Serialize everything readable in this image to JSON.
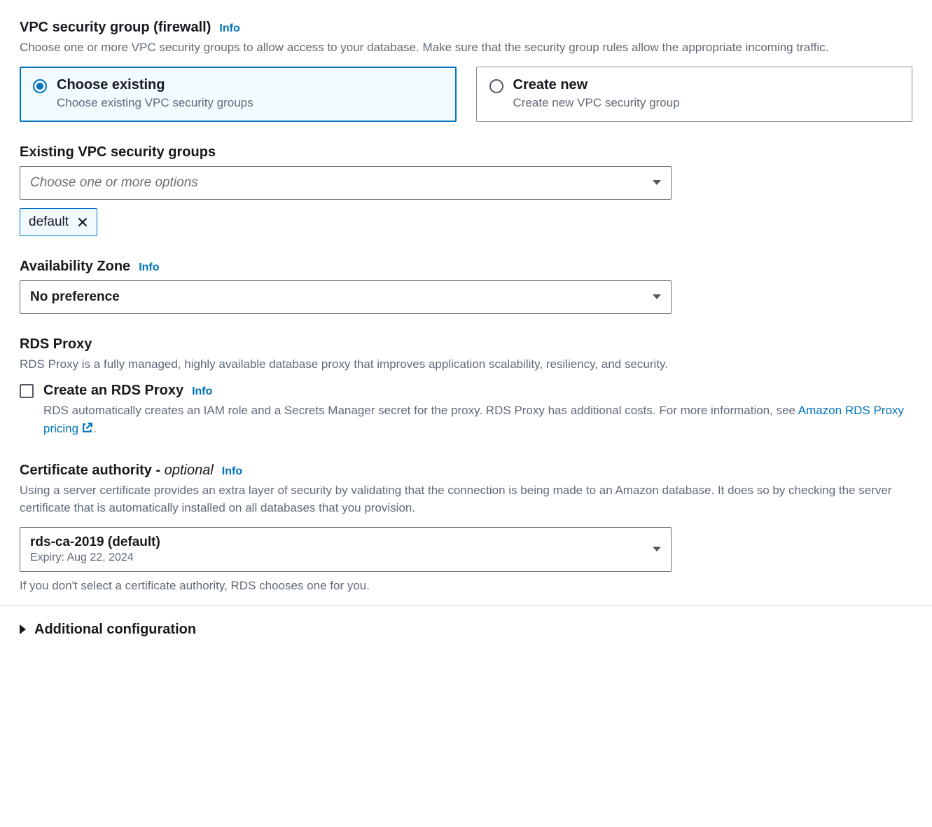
{
  "vpc_sg": {
    "label": "VPC security group (firewall)",
    "info": "Info",
    "desc": "Choose one or more VPC security groups to allow access to your database. Make sure that the security group rules allow the appropriate incoming traffic.",
    "options": {
      "existing": {
        "title": "Choose existing",
        "sub": "Choose existing VPC security groups"
      },
      "create": {
        "title": "Create new",
        "sub": "Create new VPC security group"
      }
    }
  },
  "existing_sg": {
    "label": "Existing VPC security groups",
    "placeholder": "Choose one or more options",
    "token": "default"
  },
  "az": {
    "label": "Availability Zone",
    "info": "Info",
    "value": "No preference"
  },
  "proxy": {
    "label": "RDS Proxy",
    "desc": "RDS Proxy is a fully managed, highly available database proxy that improves application scalability, resiliency, and security.",
    "checkbox_label": "Create an RDS Proxy",
    "info": "Info",
    "checkbox_desc_pre": "RDS automatically creates an IAM role and a Secrets Manager secret for the proxy. RDS Proxy has additional costs. For more information, see ",
    "link": "Amazon RDS Proxy pricing",
    "checkbox_desc_post": "."
  },
  "ca": {
    "label_main": "Certificate authority",
    "label_sep": " - ",
    "label_optional": "optional",
    "info": "Info",
    "desc": "Using a server certificate provides an extra layer of security by validating that the connection is being made to an Amazon database. It does so by checking the server certificate that is automatically installed on all databases that you provision.",
    "value": "rds-ca-2019 (default)",
    "sub": "Expiry: Aug 22, 2024",
    "helper": "If you don't select a certificate authority, RDS chooses one for you."
  },
  "additional": {
    "label": "Additional configuration"
  }
}
